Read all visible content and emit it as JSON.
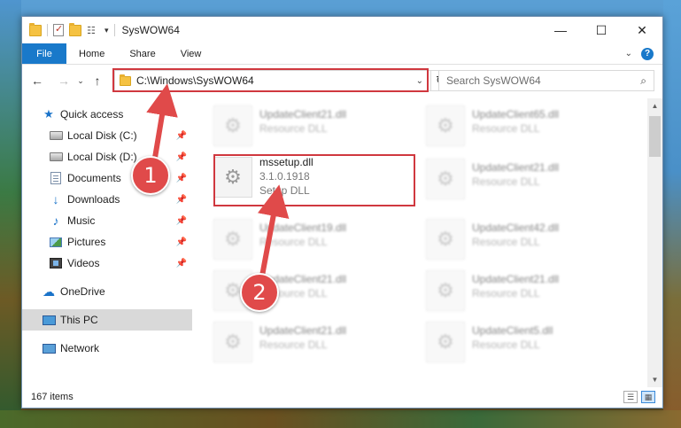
{
  "window": {
    "title": "SysWOW64",
    "controls": {
      "minimize": "—",
      "maximize": "☐",
      "close": "✕"
    }
  },
  "ribbon": {
    "file_tab": "File",
    "tabs": [
      "Home",
      "Share",
      "View"
    ]
  },
  "navigation": {
    "back": "←",
    "forward": "→",
    "recent": "⌄",
    "up": "↑",
    "address": "C:\\Windows\\SysWOW64",
    "refresh": "↻",
    "search_placeholder": "Search SysWOW64"
  },
  "sidebar": {
    "items": [
      {
        "label": "Quick access",
        "icon": "star-icon",
        "pinned": false,
        "selected": false
      },
      {
        "label": "Local Disk (C:)",
        "icon": "disk-icon",
        "pinned": true,
        "selected": false
      },
      {
        "label": "Local Disk (D:)",
        "icon": "disk-icon",
        "pinned": true,
        "selected": false
      },
      {
        "label": "Documents",
        "icon": "documents-icon",
        "pinned": true,
        "selected": false
      },
      {
        "label": "Downloads",
        "icon": "download-icon",
        "pinned": true,
        "selected": false
      },
      {
        "label": "Music",
        "icon": "music-icon",
        "pinned": true,
        "selected": false
      },
      {
        "label": "Pictures",
        "icon": "pictures-icon",
        "pinned": true,
        "selected": false
      },
      {
        "label": "Videos",
        "icon": "videos-icon",
        "pinned": true,
        "selected": false
      },
      {
        "label": "OneDrive",
        "icon": "cloud-icon",
        "pinned": false,
        "selected": false
      },
      {
        "label": "This PC",
        "icon": "pc-icon",
        "pinned": false,
        "selected": true
      },
      {
        "label": "Network",
        "icon": "network-icon",
        "pinned": false,
        "selected": false
      }
    ]
  },
  "files": {
    "left": [
      {
        "name": "UpdateClient21.dll",
        "line2": "Resource DLL",
        "line3": "",
        "blurred": true
      },
      {
        "name": "mssetup.dll",
        "line2": "3.1.0.1918",
        "line3": "Setup DLL",
        "blurred": false
      },
      {
        "name": "UpdateClient19.dll",
        "line2": "Resource DLL",
        "line3": "",
        "blurred": true
      },
      {
        "name": "UpdateClient21.dll",
        "line2": "Resource DLL",
        "line3": "",
        "blurred": true
      },
      {
        "name": "UpdateClient21.dll",
        "line2": "Resource DLL",
        "line3": "",
        "blurred": true
      }
    ],
    "right": [
      {
        "name": "UpdateClient65.dll",
        "line2": "Resource DLL",
        "line3": "",
        "blurred": true
      },
      {
        "name": "UpdateClient21.dll",
        "line2": "Resource DLL",
        "line3": "",
        "blurred": true
      },
      {
        "name": "UpdateClient42.dll",
        "line2": "Resource DLL",
        "line3": "",
        "blurred": true
      },
      {
        "name": "UpdateClient21.dll",
        "line2": "Resource DLL",
        "line3": "",
        "blurred": true
      },
      {
        "name": "UpdateClient5.dll",
        "line2": "Resource DLL",
        "line3": "",
        "blurred": true
      }
    ]
  },
  "status": {
    "item_count": "167 items"
  },
  "annotations": {
    "callout_1": "1",
    "callout_2": "2",
    "highlight_color": "#d0383f",
    "callout_color": "#e04a4a"
  }
}
